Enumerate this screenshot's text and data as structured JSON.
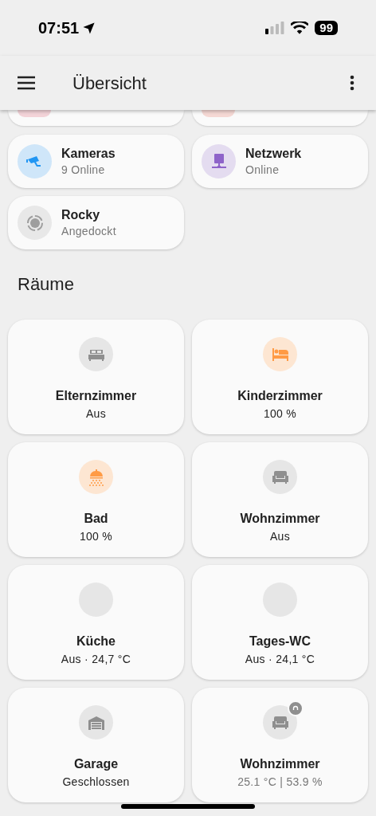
{
  "status_bar": {
    "time": "07:51",
    "battery": "99"
  },
  "header": {
    "title": "Übersicht"
  },
  "tiles": [
    {
      "name": "Kameras",
      "state": "9 Online",
      "kind": "camera",
      "color": "#2196f3"
    },
    {
      "name": "Netzwerk",
      "state": "Online",
      "kind": "network",
      "color": "#8e63c9"
    },
    {
      "name": "Rocky",
      "state": "Angedockt",
      "kind": "robot",
      "color": "#9e9e9e"
    }
  ],
  "section_title": "Räume",
  "rooms": [
    {
      "name": "Elternzimmer",
      "state": "Aus",
      "kind": "bed",
      "active": false
    },
    {
      "name": "Kinderzimmer",
      "state": "100 %",
      "kind": "bed-person",
      "active": true
    },
    {
      "name": "Bad",
      "state": "100 %",
      "kind": "shower",
      "active": true
    },
    {
      "name": "Wohnzimmer",
      "state": "Aus",
      "kind": "sofa",
      "active": false
    },
    {
      "name": "Küche",
      "state": "Aus · 24,7 °C",
      "kind": "blank",
      "active": false
    },
    {
      "name": "Tages-WC",
      "state": "Aus · 24,1 °C",
      "kind": "blank",
      "active": false
    },
    {
      "name": "Garage",
      "state": "Geschlossen",
      "kind": "garage",
      "active": false
    },
    {
      "name": "Wohnzimmer",
      "state": "25.1 °C | 53.9 %",
      "kind": "sensor",
      "active": false
    }
  ]
}
